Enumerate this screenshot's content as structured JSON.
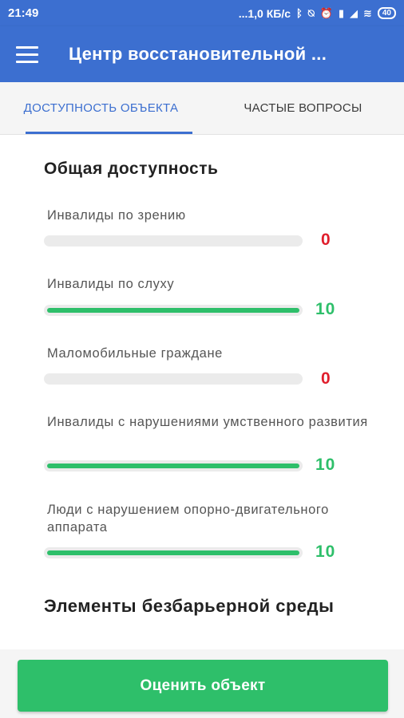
{
  "status": {
    "time": "21:49",
    "network_speed": "...1,0 КБ/с",
    "battery": "40"
  },
  "appbar": {
    "title": "Центр восстановительной ..."
  },
  "tabs": [
    {
      "label": "ДОСТУПНОСТЬ ОБЪЕКТА",
      "active": true
    },
    {
      "label": "ЧАСТЫЕ ВОПРОСЫ",
      "active": false
    }
  ],
  "general": {
    "title": "Общая доступность",
    "items": [
      {
        "label": "Инвалиды по зрению",
        "score": "0",
        "level": 0
      },
      {
        "label": "Инвалиды по слуху",
        "score": "10",
        "level": 1
      },
      {
        "label": "Маломобильные граждане",
        "score": "0",
        "level": 0
      },
      {
        "label": "Инвалиды с нарушениями умственного развития",
        "score": "10",
        "level": 1
      },
      {
        "label": "Люди с нарушением опорно-двигательного аппарата",
        "score": "10",
        "level": 1
      }
    ]
  },
  "elements": {
    "title": "Элементы безбарьерной среды"
  },
  "actions": {
    "rate_label": "Оценить объект"
  },
  "colors": {
    "primary": "#3c6fd0",
    "success": "#2ebf6a",
    "danger": "#e01e2c",
    "track": "#ebebeb"
  },
  "icons": [
    "menu-icon",
    "bluetooth-icon",
    "mute-icon",
    "alarm-icon",
    "signal-icon",
    "wifi-icon",
    "battery-icon"
  ]
}
